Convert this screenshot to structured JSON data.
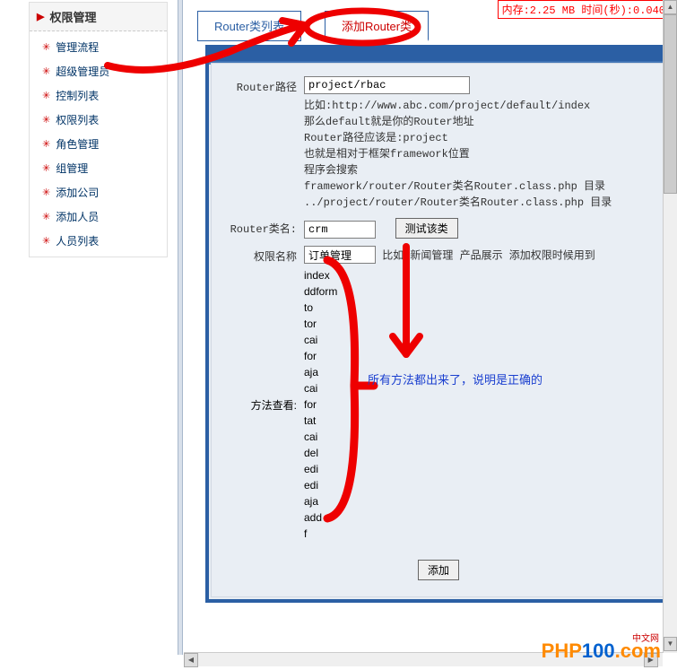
{
  "perf": {
    "text": "内存:2.25 MB 时间(秒):0.040"
  },
  "sidebar": {
    "title": "权限管理",
    "items": [
      {
        "label": "管理流程"
      },
      {
        "label": "超级管理员"
      },
      {
        "label": "控制列表"
      },
      {
        "label": "权限列表"
      },
      {
        "label": "角色管理"
      },
      {
        "label": "组管理"
      },
      {
        "label": "添加公司"
      },
      {
        "label": "添加人员"
      },
      {
        "label": "人员列表"
      }
    ]
  },
  "tabs": {
    "list_label": "Router类列表",
    "add_label": "添加Router类"
  },
  "form": {
    "path_label": "Router路径",
    "path_value": "project/rbac",
    "path_hint": "比如:http://www.abc.com/project/default/index\n那么default就是你的Router地址\nRouter路径应该是:project\n也就是相对于框架framework位置\n程序会搜索\nframework/router/Router类名Router.class.php 目录\n../project/router/Router类名Router.class.php 目录",
    "name_label": "Router类名:",
    "name_value": "crm",
    "test_btn": "测试该类",
    "perm_label": "权限名称",
    "perm_value": "订单管理",
    "perm_hint": "比如 新闻管理 产品展示 添加权限时候用到",
    "method_label": "方法查看:",
    "methods": [
      "index",
      "ddform",
      "to",
      "tor",
      "cai",
      "for",
      "aja",
      "cai",
      "for",
      "tat",
      "cai",
      "del",
      "edi",
      "edi",
      "aja",
      "add",
      "f"
    ],
    "submit_label": "添加"
  },
  "annotation": {
    "text": "所有方法都出来了，说明是正确的"
  },
  "logo": {
    "p1": "PHP",
    "p2": "100",
    "p3": ".com",
    "cn": "中文网"
  }
}
